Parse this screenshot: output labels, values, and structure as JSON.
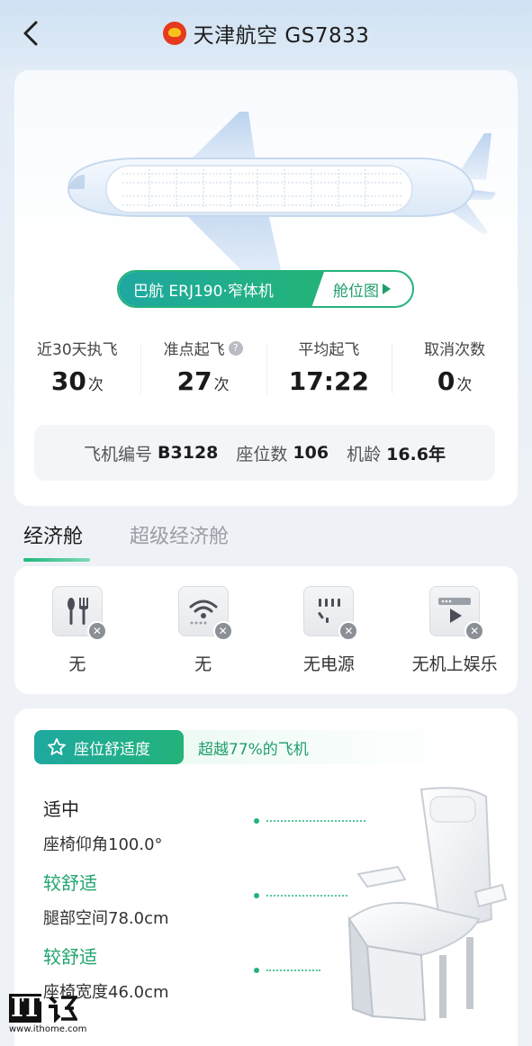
{
  "header": {
    "title": "天津航空 GS7833"
  },
  "aircraft": {
    "type_label": "巴航 ERJ190·窄体机",
    "seat_map_label": "舱位图"
  },
  "stats": [
    {
      "label": "近30天执飞",
      "value": "30",
      "unit": "次"
    },
    {
      "label": "准点起飞",
      "value": "27",
      "unit": "次",
      "help_icon": "question-icon"
    },
    {
      "label": "平均起飞",
      "value": "17:22",
      "unit": ""
    },
    {
      "label": "取消次数",
      "value": "0",
      "unit": "次"
    }
  ],
  "info": {
    "reg_label": "飞机编号",
    "reg_value": "B3128",
    "seats_label": "座位数",
    "seats_value": "106",
    "age_label": "机龄",
    "age_value": "16.6年"
  },
  "tabs": [
    {
      "label": "经济舱",
      "active": true
    },
    {
      "label": "超级经济舱",
      "active": false
    }
  ],
  "amenities": [
    {
      "icon": "meal-icon",
      "label": "无"
    },
    {
      "icon": "wifi-icon",
      "label": "无"
    },
    {
      "icon": "power-icon",
      "label": "无电源"
    },
    {
      "icon": "entertainment-icon",
      "label": "无机上娱乐"
    }
  ],
  "comfort": {
    "badge": "座位舒适度",
    "summary": "超越77%的飞机",
    "metrics": [
      {
        "level": "适中",
        "desc": "座椅仰角100.0°"
      },
      {
        "level": "较舒适",
        "desc": "腿部空间78.0cm"
      },
      {
        "level": "较舒适",
        "desc": "座椅宽度46.0cm"
      }
    ]
  },
  "watermark": {
    "logo_text": "IT",
    "url": "www.ithome.com"
  },
  "colors": {
    "accent_green": "#23b37a",
    "accent_teal": "#1ea8a0"
  }
}
